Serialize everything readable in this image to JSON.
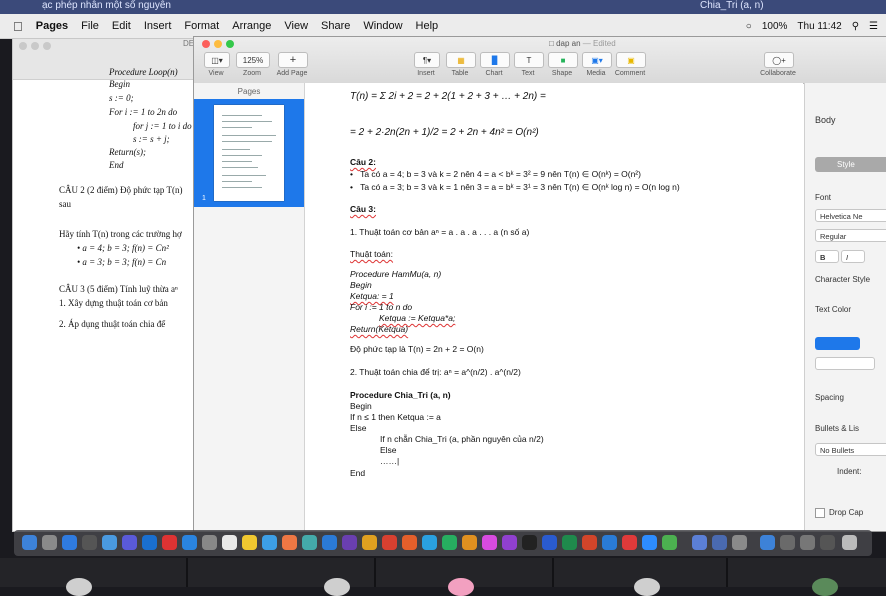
{
  "top_strip": {
    "text_left": "ạc phép nhân một số nguyên",
    "text_right": "Chia_Tri (a, n)"
  },
  "menubar": {
    "apple": "",
    "app": "Pages",
    "items": [
      "File",
      "Edit",
      "Insert",
      "Format",
      "Arrange",
      "View",
      "Share",
      "Window",
      "Help"
    ],
    "battery": "100%",
    "clock": "Thu 11:42"
  },
  "bg_window": {
    "title": "DE",
    "lines": [
      "Procedure Loop(n)",
      "Begin",
      "s := 0;",
      "For i := 1 to 2n do",
      "for j := 1 to i do",
      "s := s + j;",
      "Return(s);",
      "End",
      "CÂU 2 (2 điểm) Độ phức tạp T(n)",
      "sau",
      "Hãy tính T(n) trong các trường hợ",
      "• a = 4; b = 3; f(n) = Cn²",
      "• a = 3; b = 3; f(n) = Cn",
      "CÂU 3 (5 điểm) Tính luỹ thừa aⁿ",
      "1.   Xây dựng thuật toán cơ bản",
      "2.   Áp dụng thuật toán chia để"
    ]
  },
  "main_window": {
    "title": "dap an",
    "title_status": "— Edited",
    "toolbar": {
      "view": "View",
      "zoom_value": "125%",
      "zoom": "Zoom",
      "add_page": "Add Page",
      "insert": "Insert",
      "table": "Table",
      "chart": "Chart",
      "text": "Text",
      "shape": "Shape",
      "media": "Media",
      "comment": "Comment",
      "collaborate": "Collaborate"
    },
    "pages_header": "Pages",
    "page_number": "1"
  },
  "document": {
    "lines": [
      "T(n) = Σ 2i + 2 = 2 + 2(1 + 2 + 3 + … + 2n) =",
      "= 2 + 2·2n(2n + 1)/2 = 2 + 2n + 4n² = O(n²)",
      "Câu 2:",
      "Ta có a = 4; b = 3 và k = 2 nên 4 = a < bᵏ = 3² = 9 nên T(n) ∈ O(nᵏ) = O(n²)",
      "Ta có a = 3; b = 3 và k = 1 nên 3 = a = bᵏ = 3¹ = 3 nên T(n) ∈ O(nᵏ log n) = O(n log n)",
      "Câu 3:",
      "1.  Thuật toán cơ bản aⁿ = a . a . a . . . a (n số a)",
      "Thuật toán:",
      "Procedure HamMu(a, n)",
      "Begin",
      "Ketqua: = 1",
      "For i := 1 to n do",
      "Ketqua := Ketqua*a;",
      "Return(Ketqua)",
      "Độ phức tạp là T(n) = 2n + 2 = O(n)",
      "2.  Thuật toán chia để trị:  aⁿ = a^(n/2) . a^(n/2)",
      "Procedure Chia_Tri (a, n)",
      "Begin",
      "If n ≤ 1 then Ketqua := a",
      "Else",
      "If n chẵn Chia_Tri (a, phần nguyên của n/2)",
      "Else",
      "……|",
      "End"
    ]
  },
  "inspector": {
    "tab": "Body",
    "style_button": "Style",
    "font_label": "Font",
    "font_value": "Helvetica Ne",
    "font_style": "Regular",
    "bold": "B",
    "italic": "I",
    "char_styles": "Character Style",
    "text_color": "Text Color",
    "spacing": "Spacing",
    "bullets": "Bullets & Lis",
    "bullets_value": "No Bullets",
    "indent": "Indent:",
    "drop_cap": "Drop Cap"
  },
  "colors": {
    "accent": "#1e78ea",
    "menubar": "#ececec",
    "dock": "#46464b"
  }
}
